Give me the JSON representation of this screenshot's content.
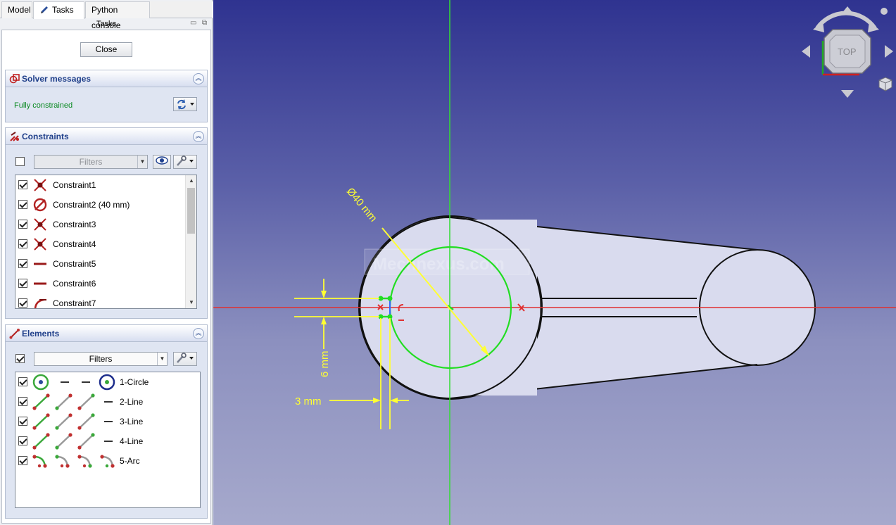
{
  "tabs": [
    {
      "label": "Model"
    },
    {
      "label": "Tasks"
    },
    {
      "label": "Python console"
    }
  ],
  "panel_title": "Tasks",
  "close_label": "Close",
  "solver": {
    "title": "Solver messages",
    "status": "Fully constrained",
    "status_color": "#0a8a22"
  },
  "constraints": {
    "title": "Constraints",
    "filter_label": "Filters",
    "items": [
      {
        "label": "Constraint1",
        "icon": "coincident-icon",
        "checked": true
      },
      {
        "label": "Constraint2 (40 mm)",
        "icon": "diameter-icon",
        "checked": true
      },
      {
        "label": "Constraint3",
        "icon": "coincident-icon",
        "checked": true
      },
      {
        "label": "Constraint4",
        "icon": "coincident-icon",
        "checked": true
      },
      {
        "label": "Constraint5",
        "icon": "horizontal-icon",
        "checked": true
      },
      {
        "label": "Constraint6",
        "icon": "horizontal-icon",
        "checked": true
      },
      {
        "label": "Constraint7",
        "icon": "tangent-icon",
        "checked": true
      }
    ]
  },
  "elements": {
    "title": "Elements",
    "filter_label": "Filters",
    "items": [
      {
        "label": "1-Circle",
        "kind": "circle",
        "checked": true
      },
      {
        "label": "2-Line",
        "kind": "line",
        "checked": true
      },
      {
        "label": "3-Line",
        "kind": "line",
        "checked": true
      },
      {
        "label": "4-Line",
        "kind": "line",
        "checked": true
      },
      {
        "label": "5-Arc",
        "kind": "arc",
        "checked": true
      }
    ]
  },
  "viewport": {
    "navcube_face": "TOP",
    "watermark": "Mechnexus.com",
    "dimensions": {
      "diameter": "Ø40 mm",
      "height": "6 mm",
      "width": "3 mm"
    },
    "colors": {
      "selection_green": "#22dd22",
      "axis_red": "#e03030",
      "dimension_yellow": "#ffff33",
      "body_fill": "#d9dbee"
    }
  }
}
